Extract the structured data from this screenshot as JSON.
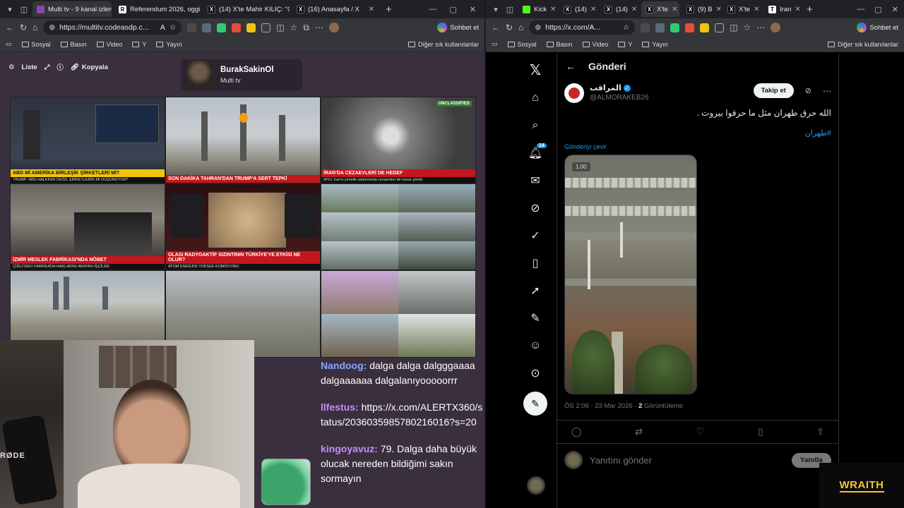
{
  "left_browser": {
    "tabs": [
      {
        "label": "Multi tv - 9 kanal izleni...",
        "active": true
      },
      {
        "label": "Referendum 2026, oggi..."
      },
      {
        "label": "(14) X'te Mahir KILIÇ: \"O..."
      },
      {
        "label": "(16) Anasayfa / X"
      }
    ],
    "url": "https://multitv.codeasdp.c...",
    "copilot": "Sohbet et",
    "bookmarks": [
      "Sosyal",
      "Basın",
      "Video",
      "Y",
      "Yayın"
    ],
    "bookmarks_other": "Diğer sık kullanılanlar"
  },
  "multitv": {
    "controls": {
      "list": "Liste",
      "copy": "Kopyala"
    },
    "profile": {
      "name": "BurakSakinOl",
      "subtitle": "Multi tv"
    },
    "streams": [
      {
        "headline": "ABD Mİ AMERİKA BİRLEŞİK ŞİRKETLERİ Mİ?",
        "sub": "TRUMP: ABD HALKININ DEĞİL ŞİRKETLERİN Mİ DÜŞÜNÜYOR?"
      },
      {
        "headline": "TAHRAN'DAN TRUMP'A SERT TEPKİ",
        "sub": "SON DAKİKA"
      },
      {
        "headline": "İRAN'DA CEZAEVLERİ DE HEDEF",
        "sub": "WSJ: İran'a yönelik saldırılarda cezaevleri de hasar gördü"
      },
      {
        "headline": "İZMİR MESLEK FABRİKASI'NDA NÖBET",
        "sub": "ÇİĞLİ'DEKİ FABRİKADA HAKLARINI ARAYAN İŞÇİLER"
      },
      {
        "headline": "OLASI RADYOAKTİF SIZINTININ TÜRKİYE'YE ETKİSİ NE OLUR?",
        "sub": "ATOM ENERJİSİ YÜKSEK KOMİSYONU"
      },
      {
        "headline": "",
        "sub": ""
      },
      {
        "headline": "",
        "sub": ""
      },
      {
        "headline": "",
        "sub": ""
      },
      {
        "headline": "",
        "sub": ""
      }
    ],
    "unclassified": "UNCLASSIFIED"
  },
  "chat": {
    "messages": [
      {
        "user": "Nandoog:",
        "text": "dalga dalga dalgggaaaa dalgaaaaaa dalgalanıyooooorrr"
      },
      {
        "user": "llfestus:",
        "text": "https://x.com/ALERTX360/status/2036035985780216016?s=20"
      },
      {
        "user": "kingoyavuz:",
        "text": "79. Dalga daha büyük olucak nereden bildiğimi sakın sormayın"
      }
    ]
  },
  "webcam": {
    "mic_brand": "RØDE"
  },
  "right_browser": {
    "tabs": [
      "Kick",
      "(14)",
      "(14)",
      "X'te",
      "(9) B",
      "X'te",
      "Iran"
    ],
    "url": "https://x.com/A...",
    "copilot": "Sohbet et",
    "bookmarks": [
      "Sosyal",
      "Basın",
      "Video",
      "Y",
      "Yayın"
    ],
    "bookmarks_other": "Diğer sık kullanılanlar"
  },
  "x_post": {
    "header": "Gönderi",
    "author_name": "المراقب",
    "author_handle": "@ALMORAKEB26",
    "follow": "Takip et",
    "text": "الله حرق طهران مثل ما حرقوا بيروت .",
    "hashtag": "#طهران",
    "translate": "Gönderiyi çevir",
    "video_speed": "1.00",
    "time": "ÖS 2:06 · 23 Mar 2026 · ",
    "views_count": "2",
    "views_label": " Görüntüleme",
    "reply_placeholder": "Yanıtını gönder",
    "reply_button": "Yanıtla",
    "notif_count": "14"
  },
  "overlay": {
    "brand": "WRAITH"
  }
}
